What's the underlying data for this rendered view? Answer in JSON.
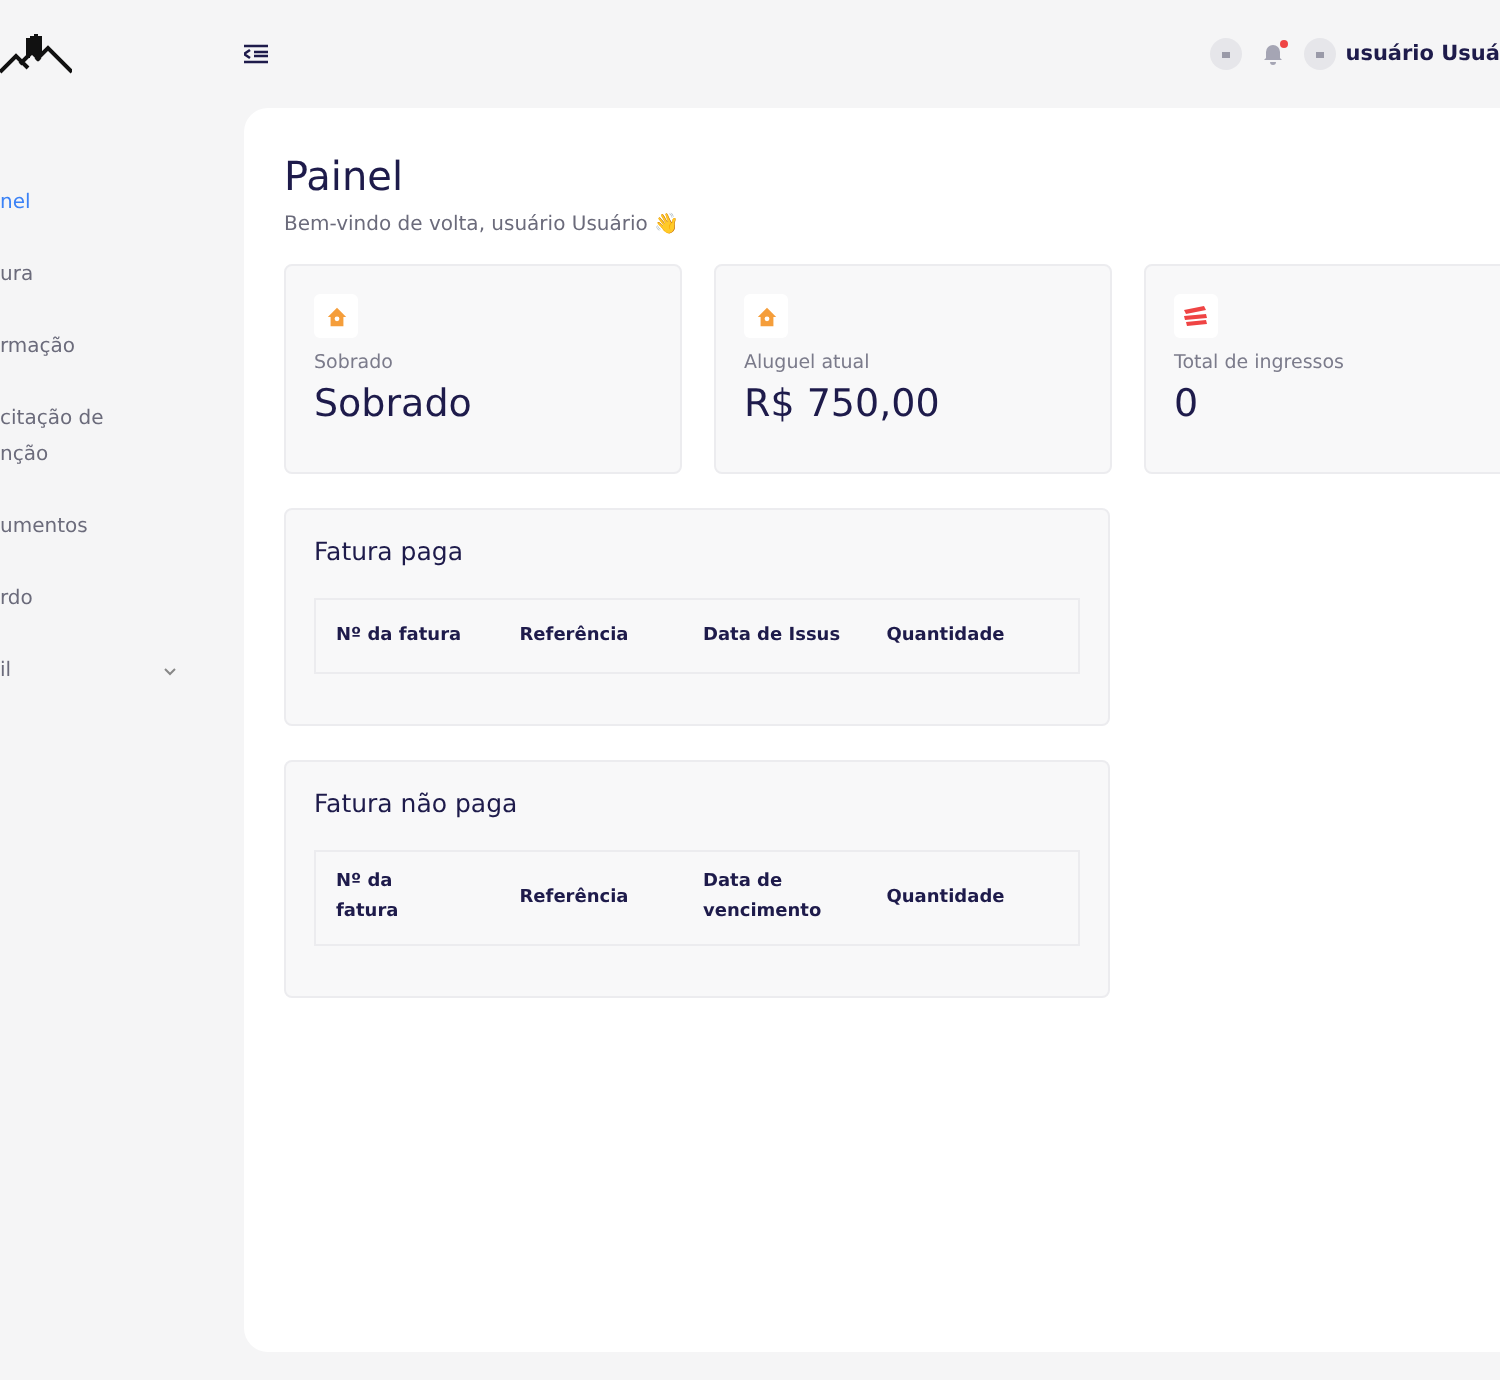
{
  "sidebar": {
    "items": [
      {
        "label": "nel",
        "selected": true
      },
      {
        "label": "ura",
        "selected": false
      },
      {
        "label": "rmação",
        "selected": false
      },
      {
        "label": "citação de nção",
        "selected": false
      },
      {
        "label": "umentos",
        "selected": false
      },
      {
        "label": "rdo",
        "selected": false
      },
      {
        "label": "il",
        "selected": false,
        "expandable": true
      }
    ]
  },
  "header": {
    "user_name": "usuário Usuá",
    "notification_unread": true
  },
  "page": {
    "title": "Painel",
    "subtitle": "Bem-vindo de volta, usuário Usuário 👋"
  },
  "stats": [
    {
      "kind": "house",
      "label": "Sobrado",
      "value": "Sobrado"
    },
    {
      "kind": "house",
      "label": "Aluguel atual",
      "value": "R$ 750,00"
    },
    {
      "kind": "tickets",
      "label": "Total de ingressos",
      "value": "0"
    }
  ],
  "tables": [
    {
      "title": "Fatura paga",
      "columns": [
        "Nº da fatura",
        "Referência",
        "Data de Issus",
        "Quantidade"
      ]
    },
    {
      "title": "Fatura não paga",
      "columns": [
        "Nº da fatura",
        "Referência",
        "Data de vencimento",
        "Quantidade"
      ]
    }
  ]
}
